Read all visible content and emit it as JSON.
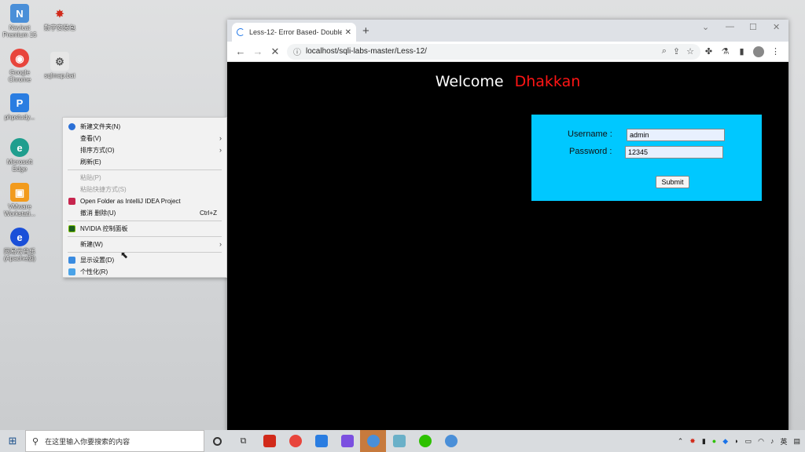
{
  "desktop": {
    "icons": [
      {
        "label": "Navicat Premium 15",
        "color": "#4a8fd8",
        "glyph": "N"
      },
      {
        "label": "数字安装包",
        "color": "#d12a1a",
        "glyph": "✸"
      },
      {
        "label": "Google Chrome",
        "color": "#e8453c",
        "glyph": "◉"
      },
      {
        "label": "sqlmap.bat",
        "color": "#e6e6e6",
        "glyph": "⚙"
      },
      {
        "label": "phpstudy...",
        "color": "#2a7de1",
        "glyph": "P"
      },
      {
        "label": "Microsoft Edge",
        "color": "#1f9e8e",
        "glyph": "e"
      },
      {
        "label": "VMware Workstati...",
        "color": "#f29b1d",
        "glyph": "▣"
      },
      {
        "label": "网易云音乐 (Apache版)",
        "color": "#1a4fd8",
        "glyph": "e"
      }
    ]
  },
  "browser": {
    "tab_title": "Less-12- Error Based- Double",
    "tab_close": "✕",
    "new_tab": "+",
    "url": "localhost/sqli-labs-master/Less-12/",
    "back": "←",
    "forward": "→",
    "reload": "✕"
  },
  "page": {
    "welcome": "Welcome",
    "name": "Dhakkan",
    "username_label": "Username :",
    "username_value": "admin",
    "password_label": "Password :",
    "password_value": "12345",
    "submit": "Submit"
  },
  "context_menu": {
    "new_folder": "新建文件夹(N)",
    "view": "查看(V)",
    "sort_by": "排序方式(O)",
    "refresh": "刷新(E)",
    "paste": "粘贴(P)",
    "paste_shortcut": "粘贴快捷方式(S)",
    "intellij": "Open Folder as IntelliJ IDEA Project",
    "undo_delete": "撤消 删除(U)",
    "undo_shortcut": "Ctrl+Z",
    "nvidia": "NVIDIA 控制面板",
    "new": "新建(W)",
    "display": "显示设置(D)",
    "personalize": "个性化(R)"
  },
  "taskbar": {
    "search_placeholder": "在这里输入你要搜索的内容",
    "ime": "英",
    "apps": [
      {
        "name": "cortana",
        "color": "#333333"
      },
      {
        "name": "task-view",
        "color": "#333333"
      },
      {
        "name": "app-red",
        "color": "#d12a1a"
      },
      {
        "name": "chrome",
        "color": "#e8453c"
      },
      {
        "name": "phpstudy",
        "color": "#2a7de1"
      },
      {
        "name": "phpstorm",
        "color": "#7b4fe0"
      },
      {
        "name": "browser-active",
        "color": "#4a8fd8"
      },
      {
        "name": "notepad",
        "color": "#6ab0c8"
      },
      {
        "name": "wechat",
        "color": "#2dc100"
      },
      {
        "name": "chrome-2",
        "color": "#4a8fd8"
      }
    ]
  }
}
